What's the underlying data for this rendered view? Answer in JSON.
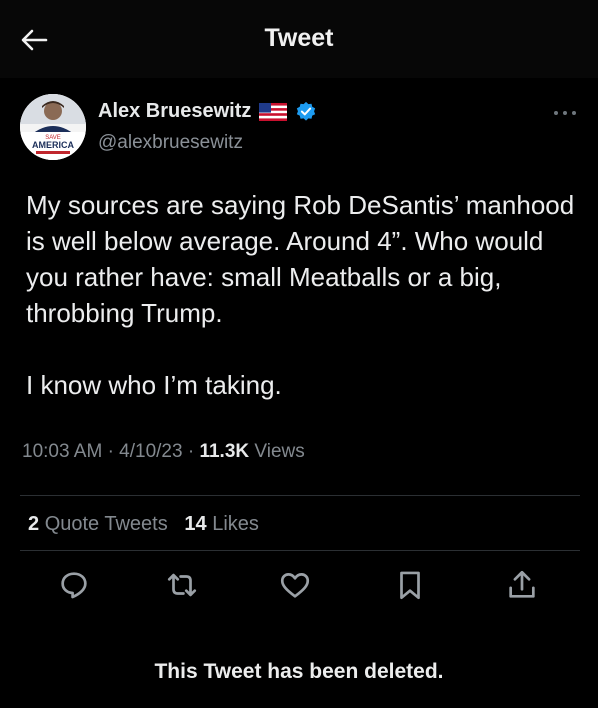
{
  "header": {
    "title": "Tweet"
  },
  "author": {
    "name": "Alex Bruesewitz",
    "handle": "@alexbruesewitz",
    "avatar_text": {
      "line1": "SAVE",
      "line2": "AMERICA"
    }
  },
  "tweet": {
    "text": "My sources are saying Rob DeSantis’ manhood is well below average. Around 4”. Who would you rather have: small Meatballs or a big, throbbing Trump.\n\nI know who I’m taking.",
    "time": "10:03 AM",
    "date": "4/10/23",
    "views_count": "11.3K",
    "views_label": "Views",
    "quote_count": "2",
    "quote_label": "Quote Tweets",
    "likes_count": "14",
    "likes_label": "Likes"
  },
  "footer": {
    "deleted_notice": "This Tweet has been deleted."
  },
  "colors": {
    "background": "#000000",
    "verified": "#1d9bf0",
    "muted": "#83898f"
  }
}
